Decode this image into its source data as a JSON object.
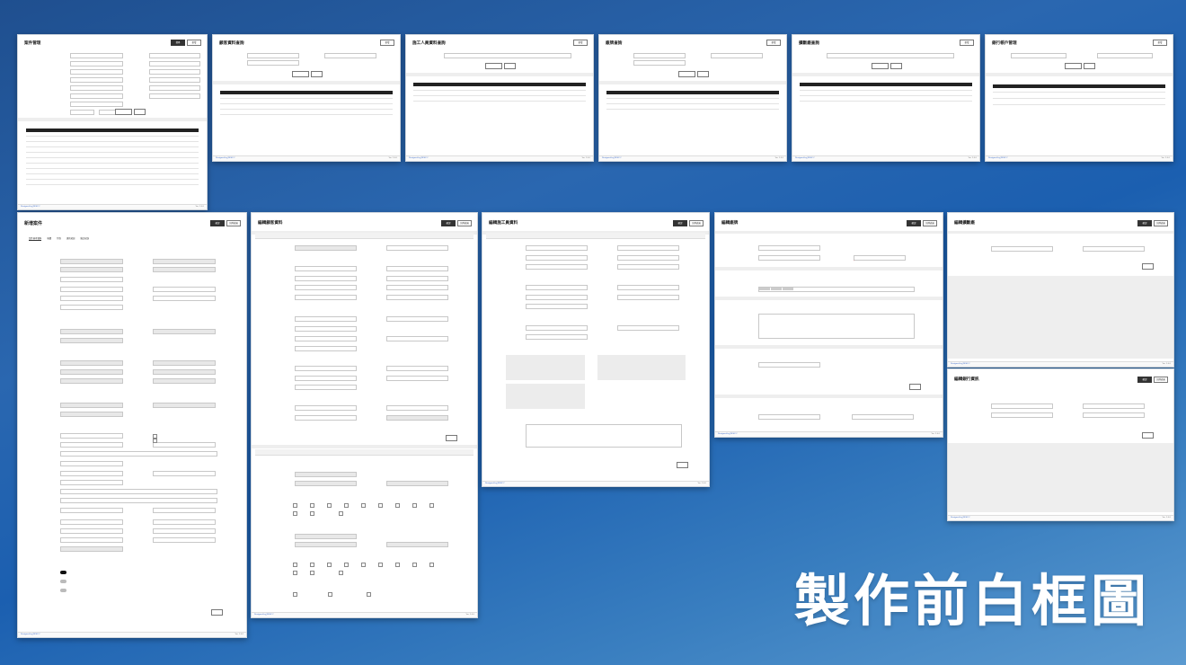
{
  "banner": "製作前白框圖",
  "footer_link": "Designed by JM/SX C",
  "footer_right": "Ver 1.0.0",
  "common": {
    "search": "搜尋",
    "add": "新增",
    "reset": "重新整理",
    "confirm": "確認",
    "back": "回列表頁"
  },
  "panels": {
    "p1": {
      "title": "案件管理"
    },
    "p2": {
      "title": "顧客資料查詢"
    },
    "p3": {
      "title": "施工人員資料查詢"
    },
    "p4": {
      "title": "廠牌查詢"
    },
    "p5": {
      "title": "擴斷廠查詢"
    },
    "p6": {
      "title": "銀行帳戶管理"
    },
    "p7": {
      "title": "新增案件",
      "tabs": [
        "案件基本資料",
        "報價",
        "付款",
        "請款紀錄",
        "備註紀錄"
      ]
    },
    "p8": {
      "title": "編輯顧客資料"
    },
    "p9": {
      "title": "編輯施工員資料"
    },
    "p10": {
      "title": "編輯廠牌"
    },
    "p11": {
      "title": "編輯擴斷廠"
    },
    "p12": {
      "title": "編輯銀行資訊"
    }
  }
}
